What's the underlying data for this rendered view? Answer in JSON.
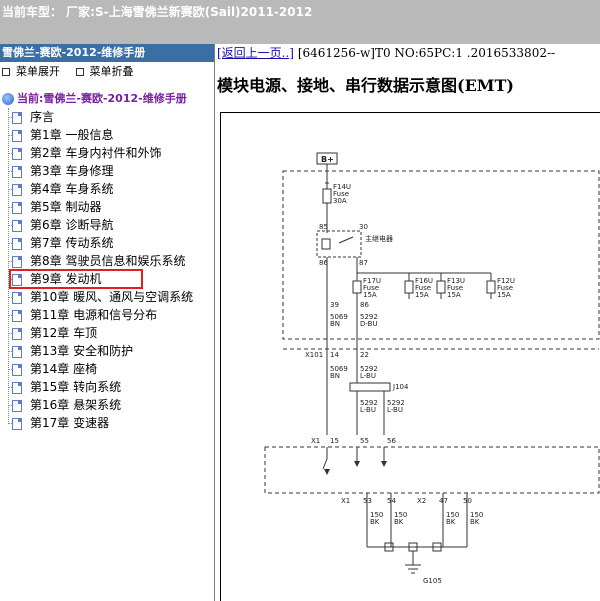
{
  "titlebar": {
    "text": "当前车型：   厂家:S-上海雪佛兰新赛欧(Sail)2011-2012"
  },
  "left": {
    "header": "雪佛兰-赛欧-2012-维修手册",
    "tools": {
      "expand": "菜单展开",
      "collapse": "菜单折叠"
    },
    "root": "当前:雪佛兰-赛欧-2012-维修手册",
    "items": [
      "序言",
      "第1章 一般信息",
      "第2章 车身内衬件和外饰",
      "第3章 车身修理",
      "第4章 车身系统",
      "第5章 制动器",
      "第6章 诊断导航",
      "第7章 传动系统",
      "第8章 驾驶员信息和娱乐系统",
      "第9章 发动机",
      "第10章 暖风、通风与空调系统",
      "第11章 电源和信号分布",
      "第12章 车顶",
      "第13章 安全和防护",
      "第14章 座椅",
      "第15章 转向系统",
      "第16章 悬架系统",
      "第17章 变速器"
    ],
    "selected_index": 9
  },
  "right": {
    "back_link": "[返回上一页..]",
    "meta": " [6461256-w]T0 NO:65PC:1 .2016533802--",
    "title": "模块电源、接地、串行数据示意图(EMT)"
  },
  "diagram": {
    "bplus": "B+",
    "f14u": [
      "F14U",
      "Fuse",
      "30A"
    ],
    "relay_label": "主继电器",
    "relay_pins": [
      "85",
      "30",
      "86",
      "87"
    ],
    "fuses": [
      {
        "id": "F17U",
        "type": "Fuse",
        "rating": "15A"
      },
      {
        "id": "F16U",
        "type": "Fuse",
        "rating": "15A"
      },
      {
        "id": "F13U",
        "type": "Fuse",
        "rating": "15A"
      },
      {
        "id": "F12U",
        "type": "Fuse",
        "rating": "15A"
      }
    ],
    "wire_a": {
      "pin": "39",
      "circuit": "5069",
      "color": "BN"
    },
    "wire_b": {
      "pin": "86",
      "circuit": "5292",
      "color": "D-BU"
    },
    "x101": {
      "label": "X101",
      "pins": [
        "14",
        "22"
      ]
    },
    "wire_c": {
      "circuit": "5069",
      "color": "BN"
    },
    "wire_d": {
      "circuit": "5292",
      "color": "L-BU"
    },
    "j104": "J104",
    "j104_wires": [
      {
        "circuit": "5292",
        "color": "L-BU"
      },
      {
        "circuit": "5292",
        "color": "L-BU"
      }
    ],
    "x1_top": {
      "label": "X1",
      "pins": [
        "15",
        "55",
        "56"
      ]
    },
    "x1_bottom": {
      "label": "X1",
      "pins": [
        "53",
        "54"
      ]
    },
    "x2_bottom": {
      "label": "X2",
      "pins": [
        "47",
        "50"
      ]
    },
    "ground_wires": [
      {
        "circuit": "150",
        "color": "BK"
      },
      {
        "circuit": "150",
        "color": "BK"
      },
      {
        "circuit": "150",
        "color": "BK"
      },
      {
        "circuit": "150",
        "color": "BK"
      }
    ],
    "ground": "G105"
  }
}
